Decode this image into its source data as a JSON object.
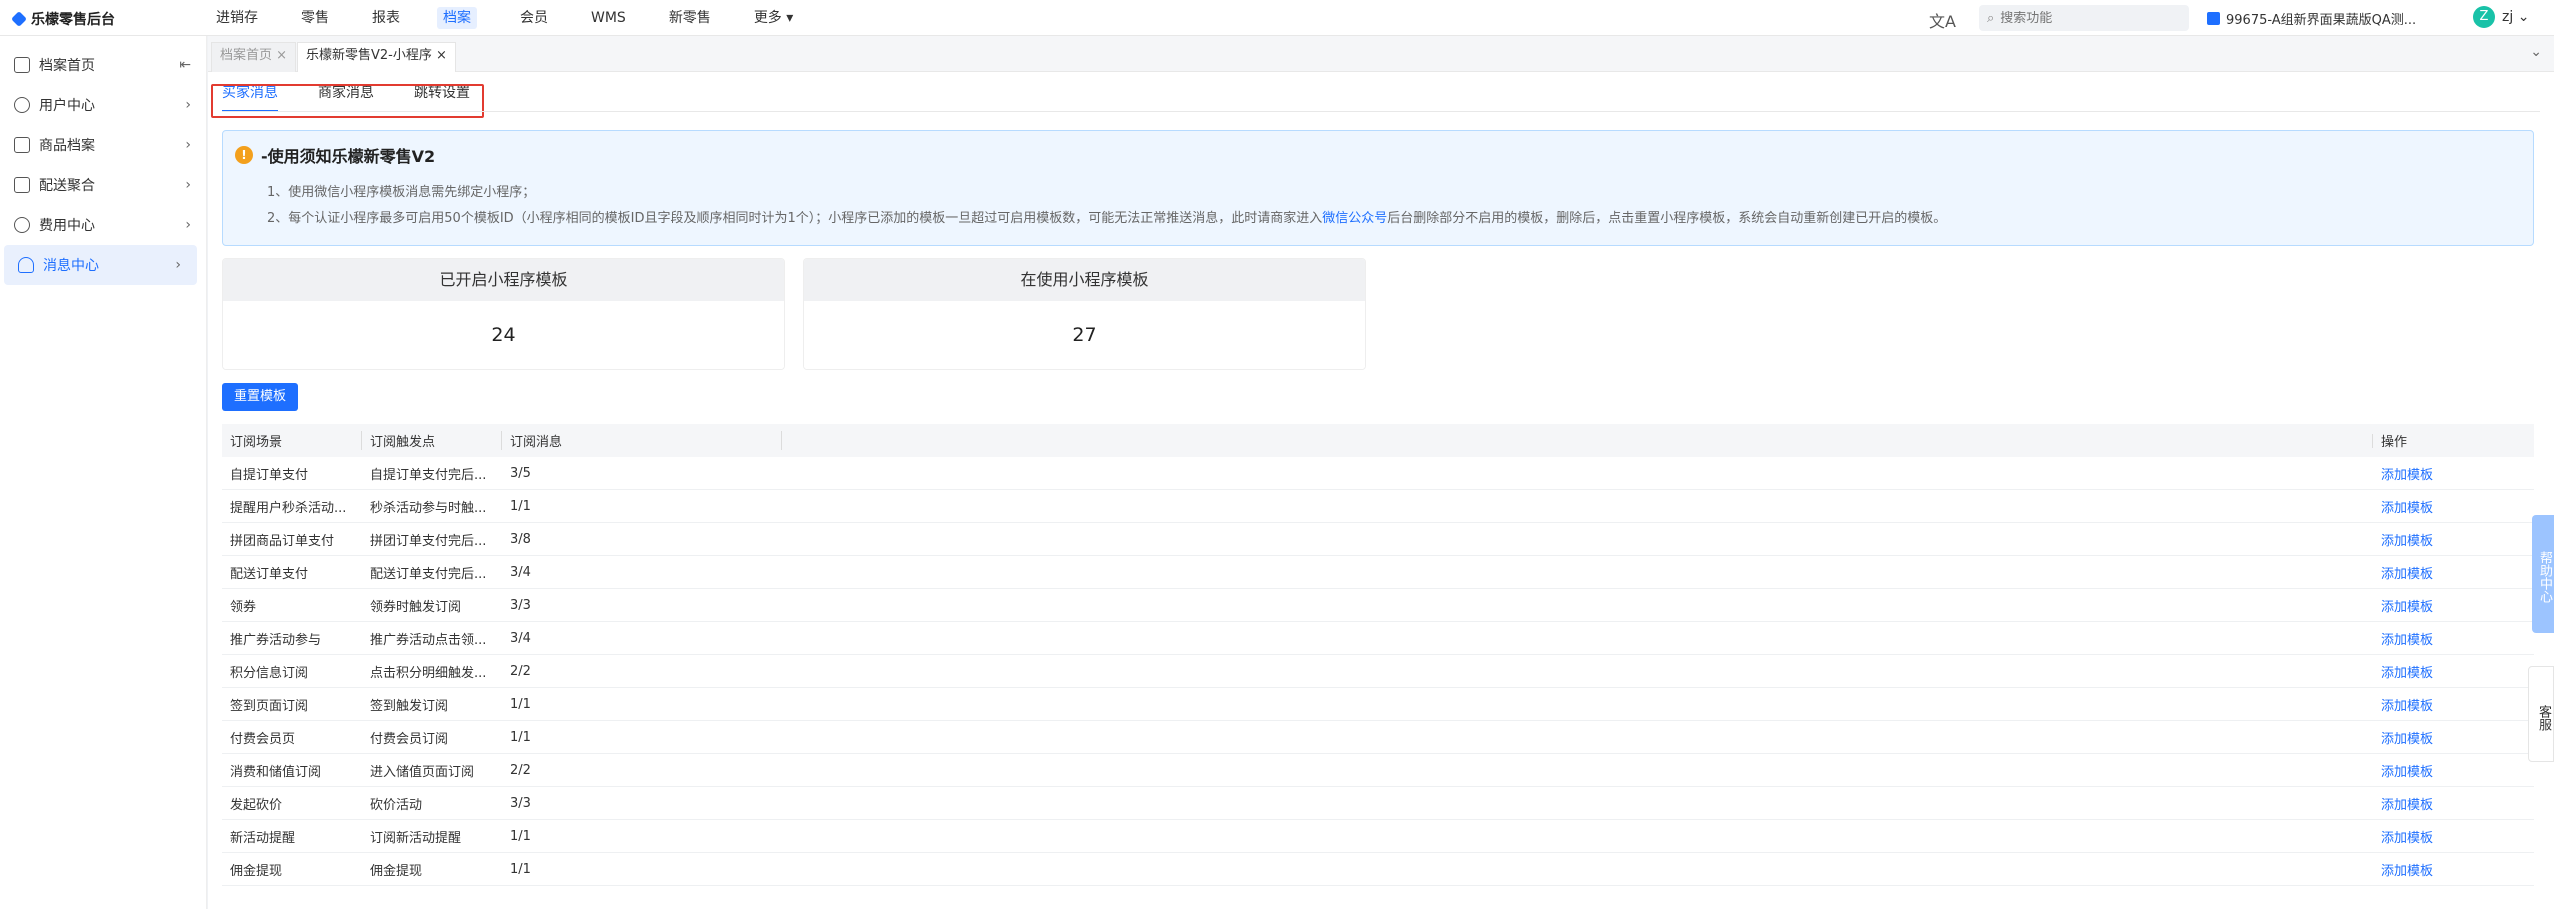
{
  "app": {
    "title": "乐檬零售后台"
  },
  "nav": [
    "进销存",
    "零售",
    "报表",
    "档案",
    "会员",
    "WMS",
    "新零售",
    "更多 ▾"
  ],
  "header": {
    "translate_icon": "文A",
    "search_placeholder": "搜索功能",
    "store_name": "99675-A组新界面果蔬版QA测...",
    "user_initial": "Z",
    "user_name": "zj ⌄"
  },
  "sidebar": [
    {
      "label": "档案首页",
      "right": "⇤"
    },
    {
      "label": "用户中心",
      "right": "›"
    },
    {
      "label": "商品档案",
      "right": "›"
    },
    {
      "label": "配送聚合",
      "right": "›"
    },
    {
      "label": "费用中心",
      "right": "›"
    },
    {
      "label": "消息中心",
      "right": "›"
    }
  ],
  "tabs": [
    {
      "label": "档案首页 ×"
    },
    {
      "label": "乐檬新零售V2-小程序 ×"
    }
  ],
  "tab_dropdown": "⌄",
  "subtabs": [
    "买家消息",
    "商家消息",
    "跳转设置"
  ],
  "notice": {
    "title": "-使用须知乐檬新零售V2",
    "line1": "1、使用微信小程序模板消息需先绑定小程序；",
    "line2_a": "2、每个认证小程序最多可启用50个模板ID（小程序相同的模板ID且字段及顺序相同时计为1个）；小程序已添加的模板一旦超过可启用模板数，可能无法正常推送消息，此时请商家进入",
    "line2_link": "微信公众号",
    "line2_b": "后台删除部分不启用的模板，删除后，点击重置小程序模板，系统会自动重新创建已开启的模板。"
  },
  "stats": [
    {
      "label": "已开启小程序模板",
      "value": "24"
    },
    {
      "label": "在使用小程序模板",
      "value": "27"
    }
  ],
  "reset_button": "重置模板",
  "table": {
    "headers": [
      "订阅场景",
      "订阅触发点",
      "订阅消息",
      "操作"
    ],
    "rows": [
      [
        "自提订单支付",
        "自提订单支付完后...",
        "3/5",
        "添加模板"
      ],
      [
        "提醒用户秒杀活动...",
        "秒杀活动参与时触...",
        "1/1",
        "添加模板"
      ],
      [
        "拼团商品订单支付",
        "拼团订单支付完后...",
        "3/8",
        "添加模板"
      ],
      [
        "配送订单支付",
        "配送订单支付完后...",
        "3/4",
        "添加模板"
      ],
      [
        "领券",
        "领券时触发订阅",
        "3/3",
        "添加模板"
      ],
      [
        "推广券活动参与",
        "推广券活动点击领...",
        "3/4",
        "添加模板"
      ],
      [
        "积分信息订阅",
        "点击积分明细触发...",
        "2/2",
        "添加模板"
      ],
      [
        "签到页面订阅",
        "签到触发订阅",
        "1/1",
        "添加模板"
      ],
      [
        "付费会员页",
        "付费会员订阅",
        "1/1",
        "添加模板"
      ],
      [
        "消费和储值订阅",
        "进入储值页面订阅",
        "2/2",
        "添加模板"
      ],
      [
        "发起砍价",
        "砍价活动",
        "3/3",
        "添加模板"
      ],
      [
        "新活动提醒",
        "订阅新活动提醒",
        "1/1",
        "添加模板"
      ],
      [
        "佣金提现",
        "佣金提现",
        "1/1",
        "添加模板"
      ]
    ]
  },
  "floats": {
    "help": "帮助中心",
    "cs": "客服"
  },
  "colors": {
    "accent": "#1e6fff",
    "highlight_box": "#e23b30",
    "notice_bg": "#eef6ff"
  }
}
